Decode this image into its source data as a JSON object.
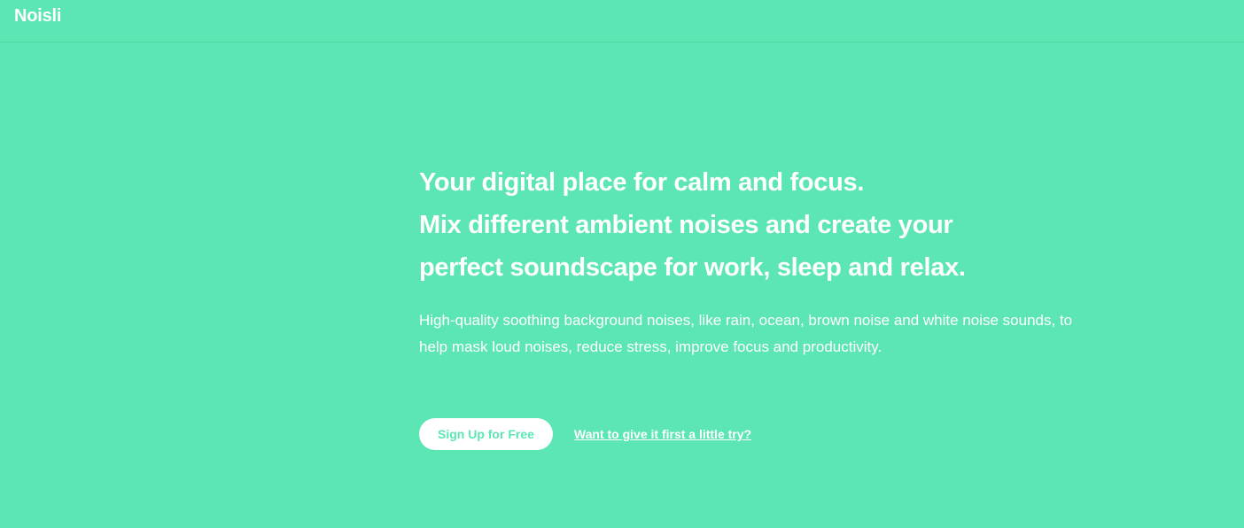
{
  "app": {
    "logo": "Noisli",
    "accent_color": "#5ce6b3",
    "text_color": "#ffffff"
  },
  "hero": {
    "headline_lines": [
      "Your digital place for calm and focus.",
      "Mix different ambient noises and create your",
      "perfect soundscape for work, sleep and relax."
    ],
    "subtext": "High-quality soothing background noises, like rain, ocean, brown noise and white noise sounds, to help mask loud noises, reduce stress, improve focus and productivity."
  },
  "cta": {
    "signup_label": "Sign Up for Free",
    "try_link_label": "Want to give it first a little try?"
  }
}
